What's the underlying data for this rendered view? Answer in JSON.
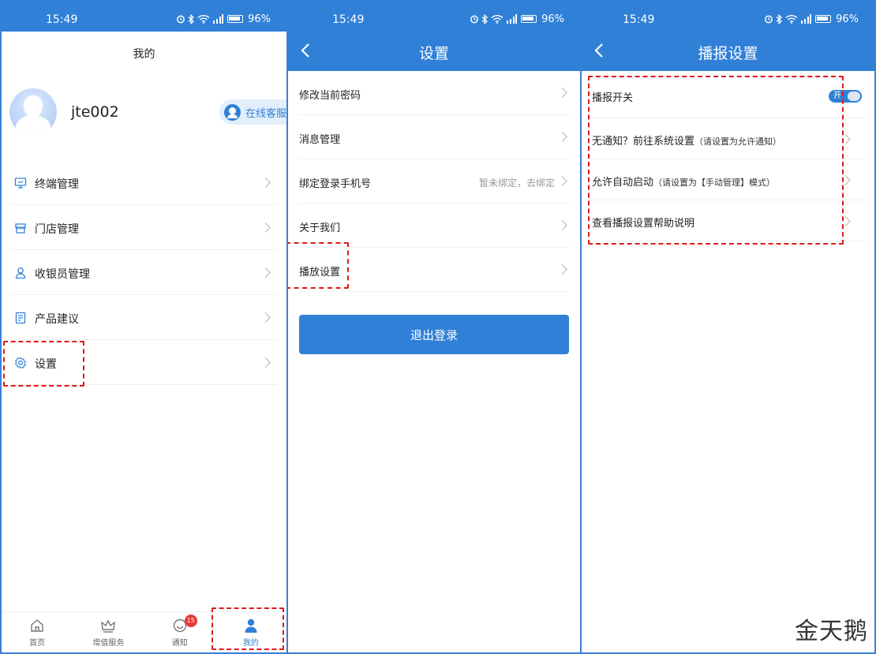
{
  "status_bar": {
    "time": "15:49",
    "battery": "96%",
    "network": "5G"
  },
  "colors": {
    "brand": "#3080d7",
    "highlight": "#e01818",
    "badge": "#e53935"
  },
  "screen_mine": {
    "title": "我的",
    "user": {
      "name": "jte002",
      "avatar_icon": "default-avatar-icon"
    },
    "customer_service": "在线客服",
    "menu": [
      {
        "label": "终端管理",
        "icon": "monitor-icon"
      },
      {
        "label": "门店管理",
        "icon": "store-icon"
      },
      {
        "label": "收银员管理",
        "icon": "user-icon"
      },
      {
        "label": "产品建议",
        "icon": "note-icon"
      },
      {
        "label": "设置",
        "icon": "gear-icon"
      }
    ],
    "tabs": [
      {
        "label": "首页",
        "icon": "home-icon"
      },
      {
        "label": "增值服务",
        "icon": "crown-icon"
      },
      {
        "label": "通知",
        "icon": "message-icon",
        "badge": "15"
      },
      {
        "label": "我的",
        "icon": "person-icon",
        "active": true
      }
    ]
  },
  "screen_settings": {
    "title": "设置",
    "menu": [
      {
        "label": "修改当前密码"
      },
      {
        "label": "消息管理"
      },
      {
        "label": "绑定登录手机号",
        "value": "暂未绑定，去绑定"
      },
      {
        "label": "关于我们"
      },
      {
        "label": "播放设置"
      }
    ],
    "logout": "退出登录"
  },
  "screen_broadcast": {
    "title": "播报设置",
    "switch": {
      "label": "播报开关",
      "state_label": "开",
      "on": true
    },
    "menu": [
      {
        "label": "无通知？前往系统设置",
        "note": "（请设置为允许通知）"
      },
      {
        "label": "允许自动启动",
        "note": "（请设置为【手动管理】模式）"
      },
      {
        "label": "查看播报设置帮助说明",
        "note": ""
      }
    ]
  },
  "watermark": "金天鹅"
}
